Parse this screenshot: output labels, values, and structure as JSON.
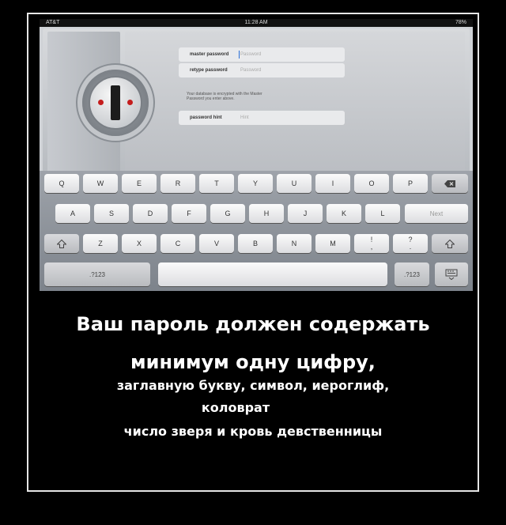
{
  "statusbar": {
    "carrier": "AT&T",
    "clock": "11:28 AM",
    "battery": "78%"
  },
  "form": {
    "master_label": "master password",
    "master_placeholder": "Password",
    "retype_label": "retype password",
    "retype_placeholder": "Password",
    "note": "Your database is encrypted with the Master Password you enter above.",
    "hint_label": "password hint",
    "hint_placeholder": "Hint"
  },
  "keyboard": {
    "row1": [
      "Q",
      "W",
      "E",
      "R",
      "T",
      "Y",
      "U",
      "I",
      "O",
      "P"
    ],
    "row2": [
      "A",
      "S",
      "D",
      "F",
      "G",
      "H",
      "J",
      "K",
      "L"
    ],
    "row3": [
      "Z",
      "X",
      "C",
      "V",
      "B",
      "N",
      "M"
    ],
    "next": "Next",
    "punct1": [
      "!",
      ","
    ],
    "punct2": [
      "?",
      "."
    ],
    "numbers_left": ".?123",
    "numbers_right": ".?123",
    "backspace_icon": "backspace-icon",
    "shift_icon": "shift-icon",
    "hide_icon": "keyboard-hide-icon"
  },
  "caption": {
    "line1": "Ваш пароль должен содержать",
    "line2": "минимум одну цифру,",
    "line3": "заглавную букву, символ, иероглиф,",
    "line4": "коловрат",
    "line5": "число зверя и  кровь девственницы"
  }
}
